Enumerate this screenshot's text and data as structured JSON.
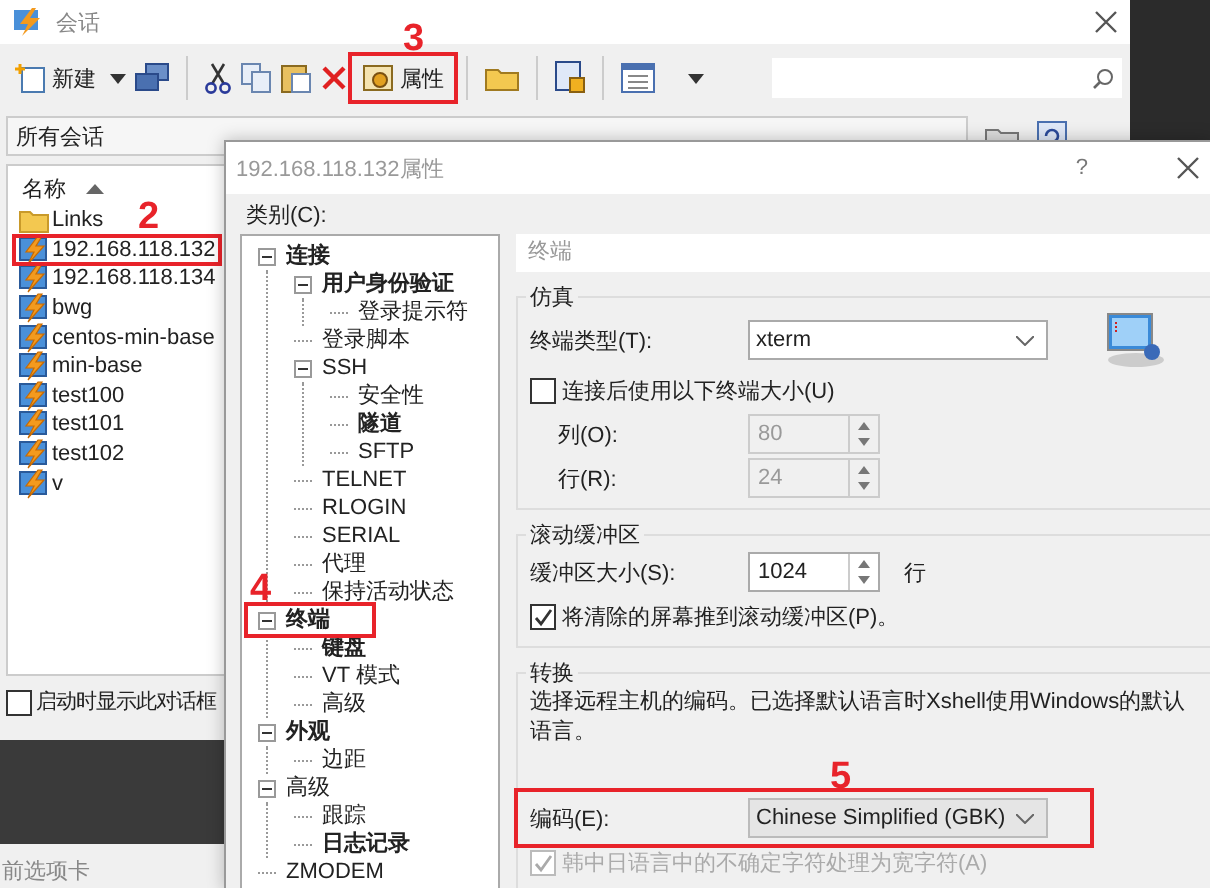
{
  "window": {
    "title": "会话"
  },
  "toolbar": {
    "new_label": "新建",
    "properties": {
      "label": "属性",
      "annotation": "3"
    }
  },
  "address_bar": {
    "value": "所有会话"
  },
  "session_list": {
    "header": "名称",
    "items": [
      {
        "kind": "folder",
        "name": "Links"
      },
      {
        "kind": "session",
        "name": "192.168.118.132",
        "annotation": "2"
      },
      {
        "kind": "session",
        "name": "192.168.118.134"
      },
      {
        "kind": "session",
        "name": "bwg"
      },
      {
        "kind": "session",
        "name": "centos-min-base"
      },
      {
        "kind": "session",
        "name": "min-base"
      },
      {
        "kind": "session",
        "name": "test100"
      },
      {
        "kind": "session",
        "name": "test101"
      },
      {
        "kind": "session",
        "name": "test102"
      },
      {
        "kind": "session",
        "name": "v"
      }
    ]
  },
  "startup_checkbox": {
    "label": "启动时显示此对话框",
    "checked": false
  },
  "status_bar": {
    "text": "前选项卡"
  },
  "dialog": {
    "title": "192.168.118.132属性",
    "help": "?",
    "category_label": "类别(C):",
    "tree": [
      {
        "label": "连接",
        "bold": true,
        "expanded": true,
        "children": [
          {
            "label": "用户身份验证",
            "bold": true,
            "expanded": true,
            "children": [
              {
                "label": "登录提示符",
                "bold": false
              }
            ]
          },
          {
            "label": "登录脚本",
            "bold": false
          },
          {
            "label": "SSH",
            "bold": false,
            "expanded": true,
            "children": [
              {
                "label": "安全性",
                "bold": false
              },
              {
                "label": "隧道",
                "bold": true
              },
              {
                "label": "SFTP",
                "bold": false
              }
            ]
          },
          {
            "label": "TELNET",
            "bold": false
          },
          {
            "label": "RLOGIN",
            "bold": false
          },
          {
            "label": "SERIAL",
            "bold": false
          },
          {
            "label": "代理",
            "bold": false
          },
          {
            "label": "保持活动状态",
            "bold": false
          }
        ]
      },
      {
        "label": "终端",
        "bold": true,
        "expanded": true,
        "annotation": "4",
        "children": [
          {
            "label": "键盘",
            "bold": true
          },
          {
            "label": "VT 模式",
            "bold": false
          },
          {
            "label": "高级",
            "bold": false
          }
        ]
      },
      {
        "label": "外观",
        "bold": true,
        "expanded": true,
        "children": [
          {
            "label": "边距",
            "bold": false
          }
        ]
      },
      {
        "label": "高级",
        "bold": false,
        "expanded": true,
        "children": [
          {
            "label": "跟踪",
            "bold": false
          },
          {
            "label": "日志记录",
            "bold": true
          }
        ]
      },
      {
        "label": "ZMODEM",
        "bold": false
      }
    ],
    "panel": {
      "header": "终端",
      "emulation": {
        "title": "仿真",
        "terminal_type_label": "终端类型(T):",
        "terminal_type": "xterm",
        "use_size": {
          "label": "连接后使用以下终端大小(U)",
          "checked": false
        },
        "columns_label": "列(O):",
        "columns": "80",
        "rows_label": "行(R):",
        "rows": "24"
      },
      "scrollback": {
        "title": "滚动缓冲区",
        "size_label": "缓冲区大小(S):",
        "size": "1024",
        "unit": "行",
        "push": {
          "label": "将清除的屏幕推到滚动缓冲区(P)。",
          "checked": true
        }
      },
      "translation": {
        "title": "转换",
        "description": "选择远程主机的编码。已选择默认语言时Xshell使用Windows的默认语言。",
        "encoding_label": "编码(E):",
        "encoding": "Chinese Simplified (GBK)",
        "annotation": "5",
        "cjk": {
          "label": "韩中日语言中的不确定字符处理为宽字符(A)",
          "checked": true,
          "disabled": true
        }
      }
    }
  }
}
